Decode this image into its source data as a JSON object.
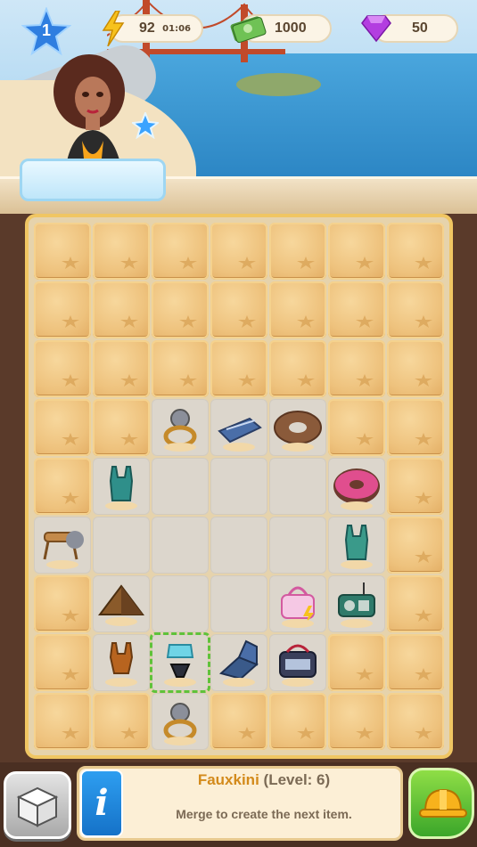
{
  "hud": {
    "level": "1",
    "energy": "92",
    "energy_timer": "01:06",
    "cash": "1000",
    "gems": "50"
  },
  "icons": {
    "level": "star-icon",
    "energy": "lightning-icon",
    "cash": "cash-icon",
    "gems": "gem-icon"
  },
  "board": {
    "rows": 9,
    "cols": 7,
    "cells": [
      [
        "sand",
        "sand",
        "sand",
        "sand",
        "sand",
        "sand",
        "sand"
      ],
      [
        "sand",
        "sand",
        "sand",
        "sand",
        "sand",
        "sand",
        "sand"
      ],
      [
        "sand",
        "sand",
        "sand",
        "sand",
        "sand",
        "sand",
        "sand"
      ],
      [
        "sand",
        "sand",
        "ring",
        "deck-chair",
        "donut",
        "sand",
        "sand"
      ],
      [
        "sand",
        "swimsuit",
        "empty",
        "empty",
        "empty",
        "donut-pink",
        "sand"
      ],
      [
        "stool",
        "empty",
        "empty",
        "empty",
        "empty",
        "tank-top",
        "sand"
      ],
      [
        "sand",
        "pyramid",
        "empty",
        "empty",
        "beach-bag",
        "radio",
        "sand"
      ],
      [
        "sand",
        "one-piece",
        "fauxkini",
        "lounge-chair",
        "cooler-bag",
        "sand",
        "sand"
      ],
      [
        "sand",
        "sand",
        "ring",
        "sand",
        "sand",
        "sand",
        "sand"
      ]
    ],
    "selected": {
      "row": 7,
      "col": 2
    }
  },
  "info": {
    "item_name": "Fauxkini",
    "item_level": "(Level: 6)",
    "description": "Merge to create the next item.",
    "icon_letter": "i"
  },
  "colors": {
    "board_border": "#f0c663",
    "selection": "#5fc23a",
    "title_orange": "#d38a1b",
    "info_blue": "#1572c8",
    "action_green": "#3ba62a"
  }
}
